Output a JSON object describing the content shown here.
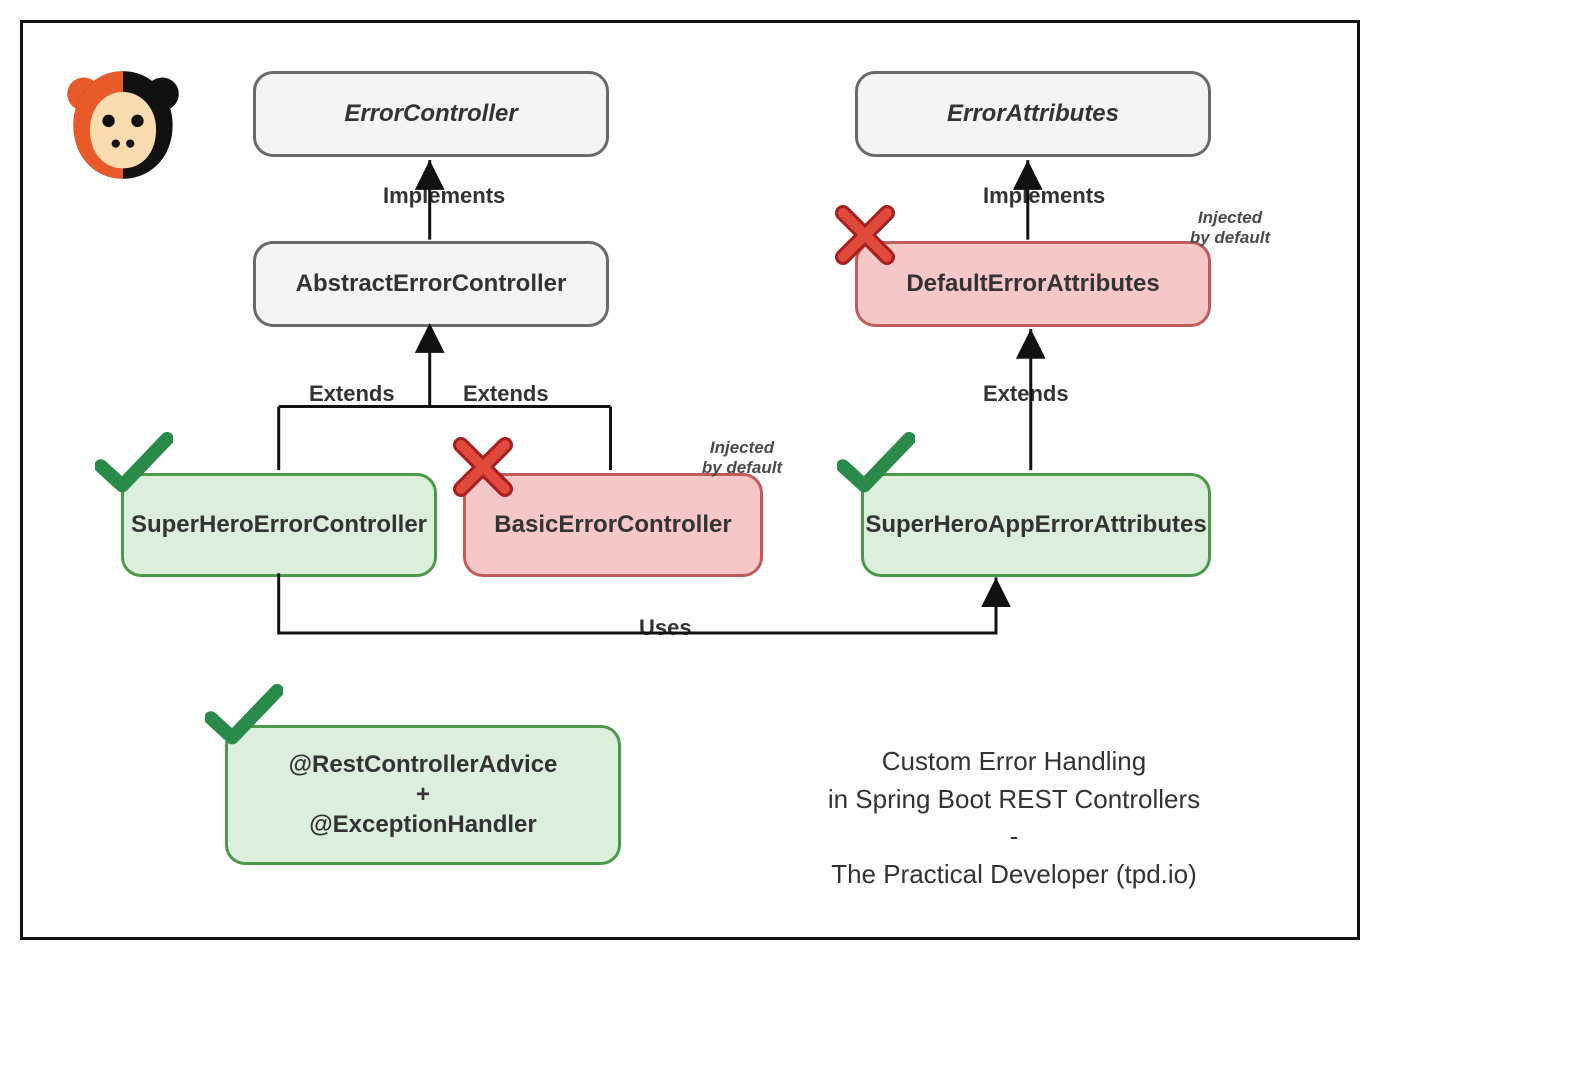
{
  "nodes": {
    "error_controller": "ErrorController",
    "error_attributes": "ErrorAttributes",
    "abstract_error_controller": "AbstractErrorController",
    "default_error_attributes": "DefaultErrorAttributes",
    "superhero_error_controller": "SuperHeroErrorController",
    "basic_error_controller": "BasicErrorController",
    "superhero_app_error_attributes": "SuperHeroAppErrorAttributes",
    "advice_line1": "@RestControllerAdvice",
    "advice_plus": "+",
    "advice_line2": "@ExceptionHandler"
  },
  "edges": {
    "implements_left": "Implements",
    "implements_right": "Implements",
    "extends_left": "Extends",
    "extends_mid": "Extends",
    "extends_right": "Extends",
    "uses": "Uses"
  },
  "annotations": {
    "injected_by_default_l1": "Injected",
    "injected_by_default_l2": "by default"
  },
  "caption": {
    "l1": "Custom Error Handling",
    "l2": "in Spring Boot REST Controllers",
    "l3": "-",
    "l4": "The Practical Developer (tpd.io)"
  }
}
